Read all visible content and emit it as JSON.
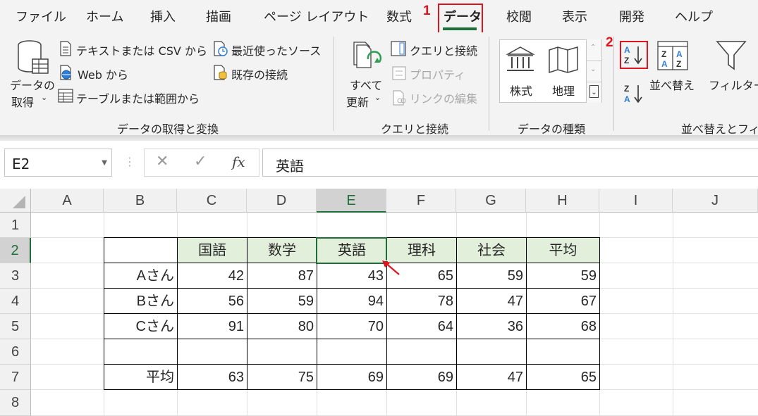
{
  "tabs": {
    "file": "ファイル",
    "home": "ホーム",
    "insert": "挿入",
    "draw": "描画",
    "page_layout": "ページ レイアウト",
    "formulas": "数式",
    "data": "データ",
    "review": "校閲",
    "view": "表示",
    "developer": "開発",
    "help": "ヘルプ"
  },
  "steps": {
    "step1": "1",
    "step2": "2"
  },
  "ribbon": {
    "get_data_line1": "データの",
    "get_data_line2": "取得",
    "from_text_csv": "テキストまたは CSV から",
    "from_web": "Web から",
    "from_table": "テーブルまたは範囲から",
    "recent_sources": "最近使ったソース",
    "existing_connections": "既存の接続",
    "group_get_transform": "データの取得と変換",
    "refresh_line1": "すべて",
    "refresh_line2": "更新",
    "queries_connections": "クエリと接続",
    "properties": "プロパティ",
    "edit_links": "リンクの編集",
    "group_queries": "クエリと接続",
    "stocks": "株式",
    "geography": "地理",
    "group_data_types": "データの種類",
    "sort": "並べ替え",
    "filter": "フィルター",
    "group_sort_filter": "並べ替えとフィル"
  },
  "formula_bar": {
    "name_box": "E2",
    "formula": "英語"
  },
  "sheet": {
    "columns": [
      "A",
      "B",
      "C",
      "D",
      "E",
      "F",
      "G",
      "H",
      "I",
      "J"
    ],
    "rows": [
      "1",
      "2",
      "3",
      "4",
      "5",
      "6",
      "7",
      "8"
    ],
    "headers": [
      "国語",
      "数学",
      "英語",
      "理科",
      "社会",
      "平均"
    ],
    "labels": [
      "Aさん",
      "Bさん",
      "Cさん",
      "",
      "平均"
    ],
    "values": [
      [
        "42",
        "87",
        "43",
        "65",
        "59",
        "59"
      ],
      [
        "56",
        "59",
        "94",
        "78",
        "47",
        "67"
      ],
      [
        "91",
        "80",
        "70",
        "64",
        "36",
        "68"
      ],
      [
        "",
        "",
        "",
        "",
        "",
        ""
      ],
      [
        "63",
        "75",
        "69",
        "69",
        "47",
        "65"
      ]
    ]
  },
  "colors": {
    "excel_green": "#1e6e3a",
    "highlight_red": "#e0141e",
    "header_fill": "#e2efda"
  }
}
